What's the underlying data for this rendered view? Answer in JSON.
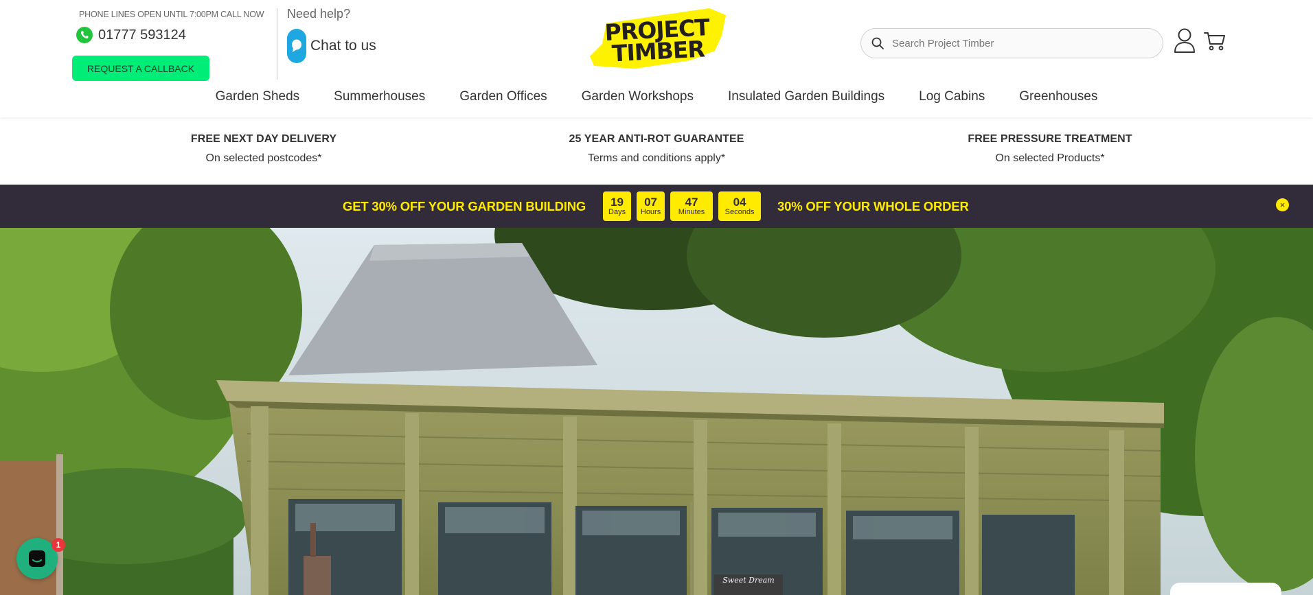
{
  "header": {
    "phone_hours": "PHONE LINES OPEN UNTIL 7:00PM CALL NOW",
    "phone_number": "01777 593124",
    "callback_label": "REQUEST A CALLBACK",
    "help_title": "Need help?",
    "chat_label": "Chat to us",
    "logo_line1": "PROJECT",
    "logo_line2": "TIMBER",
    "search_placeholder": "Search Project Timber"
  },
  "nav": {
    "items": [
      {
        "label": "Garden Sheds"
      },
      {
        "label": "Summerhouses"
      },
      {
        "label": "Garden Offices"
      },
      {
        "label": "Garden Workshops"
      },
      {
        "label": "Insulated Garden Buildings"
      },
      {
        "label": "Log Cabins"
      },
      {
        "label": "Greenhouses"
      }
    ]
  },
  "usps": [
    {
      "title": "FREE NEXT DAY DELIVERY",
      "subtitle": "On selected postcodes*"
    },
    {
      "title": "25 YEAR ANTI-ROT GUARANTEE",
      "subtitle": "Terms and conditions apply*"
    },
    {
      "title": "FREE PRESSURE TREATMENT",
      "subtitle": "On selected Products*"
    }
  ],
  "promo": {
    "left_text": "GET 30% OFF YOUR GARDEN BUILDING",
    "right_text": "30% OFF YOUR WHOLE ORDER",
    "countdown": [
      {
        "value": "19",
        "unit": "Days"
      },
      {
        "value": "07",
        "unit": "Hours"
      },
      {
        "value": "47",
        "unit": "Minutes"
      },
      {
        "value": "04",
        "unit": "Seconds"
      }
    ],
    "close_symbol": "×"
  },
  "hero": {
    "sign_text": "Sweet Dream"
  },
  "chat_widget": {
    "badge_count": "1"
  },
  "colors": {
    "accent_green": "#00ee77",
    "promo_bg": "#322b3a",
    "promo_yellow": "#ffeb00",
    "logo_yellow": "#fff200"
  }
}
